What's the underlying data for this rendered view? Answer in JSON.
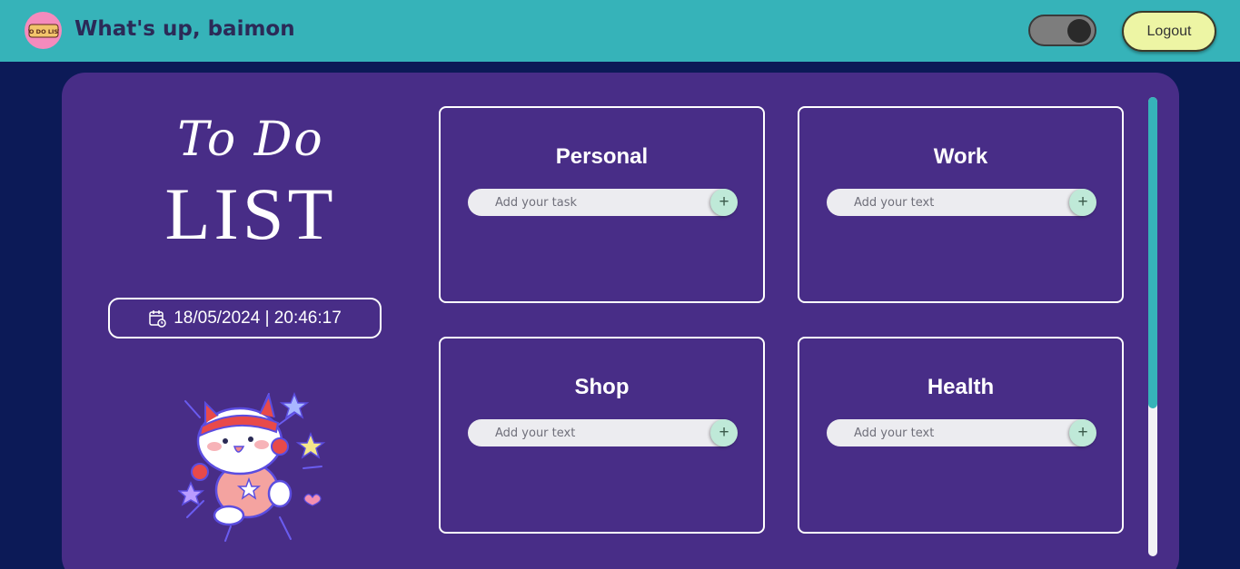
{
  "header": {
    "logo_text": "TO DO LIST",
    "greeting": "What's up, baimon",
    "logout_label": "Logout"
  },
  "sidebar": {
    "title_script": "To Do",
    "title_main": "LIST",
    "datetime": "18/05/2024 | 20:46:17"
  },
  "cards": [
    {
      "title": "Personal",
      "placeholder": "Add your task",
      "add_label": "+"
    },
    {
      "title": "Work",
      "placeholder": "Add your text",
      "add_label": "+"
    },
    {
      "title": "Shop",
      "placeholder": "Add your text",
      "add_label": "+"
    },
    {
      "title": "Health",
      "placeholder": "Add your text",
      "add_label": "+"
    }
  ],
  "colors": {
    "header_bg": "#36b3b9",
    "page_bg": "#0c1a57",
    "panel_bg": "#482d87",
    "logout_bg": "#edf5a4",
    "add_button_bg": "#bfe9d8",
    "scroll_thumb": "#36b3b9"
  },
  "icons": {
    "calendar": "calendar-clock-icon",
    "add": "plus-icon"
  },
  "theme_toggle": {
    "state": "on"
  }
}
